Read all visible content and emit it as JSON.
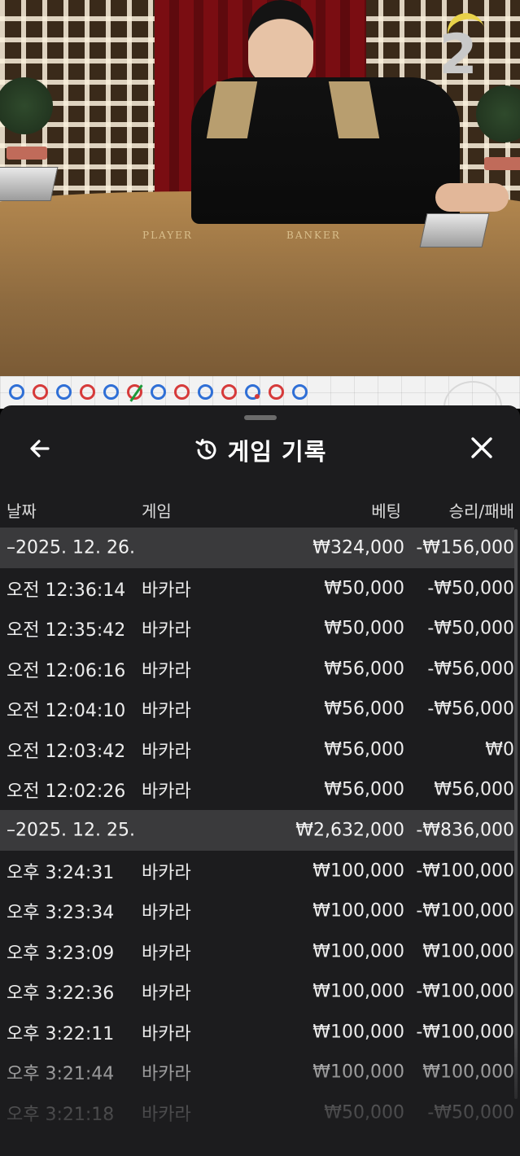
{
  "video": {
    "countdown": "2",
    "table_labels": {
      "player": "PLAYER",
      "banker": "BANKER"
    }
  },
  "road": {
    "beads": [
      "blue",
      "red",
      "blue",
      "red",
      "blue",
      "tie",
      "blue",
      "red",
      "blue",
      "red",
      "blue-dot",
      "red",
      "blue"
    ]
  },
  "header": {
    "title": "게임 기록",
    "back_icon": "arrow-left-icon",
    "title_icon": "history-icon",
    "close_icon": "close-icon"
  },
  "columns": {
    "date": "날짜",
    "game": "게임",
    "bet": "베팅",
    "result": "승리/패배"
  },
  "groups": [
    {
      "date": "–2025. 12. 26.",
      "bet_total": "₩324,000",
      "result_total": "-₩156,000",
      "rows": [
        {
          "time": "오전 12:36:14",
          "game": "바카라",
          "bet": "₩50,000",
          "result": "-₩50,000"
        },
        {
          "time": "오전 12:35:42",
          "game": "바카라",
          "bet": "₩50,000",
          "result": "-₩50,000"
        },
        {
          "time": "오전 12:06:16",
          "game": "바카라",
          "bet": "₩56,000",
          "result": "-₩56,000"
        },
        {
          "time": "오전 12:04:10",
          "game": "바카라",
          "bet": "₩56,000",
          "result": "-₩56,000"
        },
        {
          "time": "오전 12:03:42",
          "game": "바카라",
          "bet": "₩56,000",
          "result": "₩0"
        },
        {
          "time": "오전 12:02:26",
          "game": "바카라",
          "bet": "₩56,000",
          "result": "₩56,000"
        }
      ]
    },
    {
      "date": "–2025. 12. 25.",
      "bet_total": "₩2,632,000",
      "result_total": "-₩836,000",
      "rows": [
        {
          "time": "오후 3:24:31",
          "game": "바카라",
          "bet": "₩100,000",
          "result": "-₩100,000"
        },
        {
          "time": "오후 3:23:34",
          "game": "바카라",
          "bet": "₩100,000",
          "result": "-₩100,000"
        },
        {
          "time": "오후 3:23:09",
          "game": "바카라",
          "bet": "₩100,000",
          "result": "₩100,000"
        },
        {
          "time": "오후 3:22:36",
          "game": "바카라",
          "bet": "₩100,000",
          "result": "-₩100,000"
        },
        {
          "time": "오후 3:22:11",
          "game": "바카라",
          "bet": "₩100,000",
          "result": "-₩100,000"
        },
        {
          "time": "오후 3:21:44",
          "game": "바카라",
          "bet": "₩100,000",
          "result": "₩100,000"
        },
        {
          "time": "오후 3:21:18",
          "game": "바카라",
          "bet": "₩50,000",
          "result": "-₩50,000"
        }
      ]
    }
  ]
}
